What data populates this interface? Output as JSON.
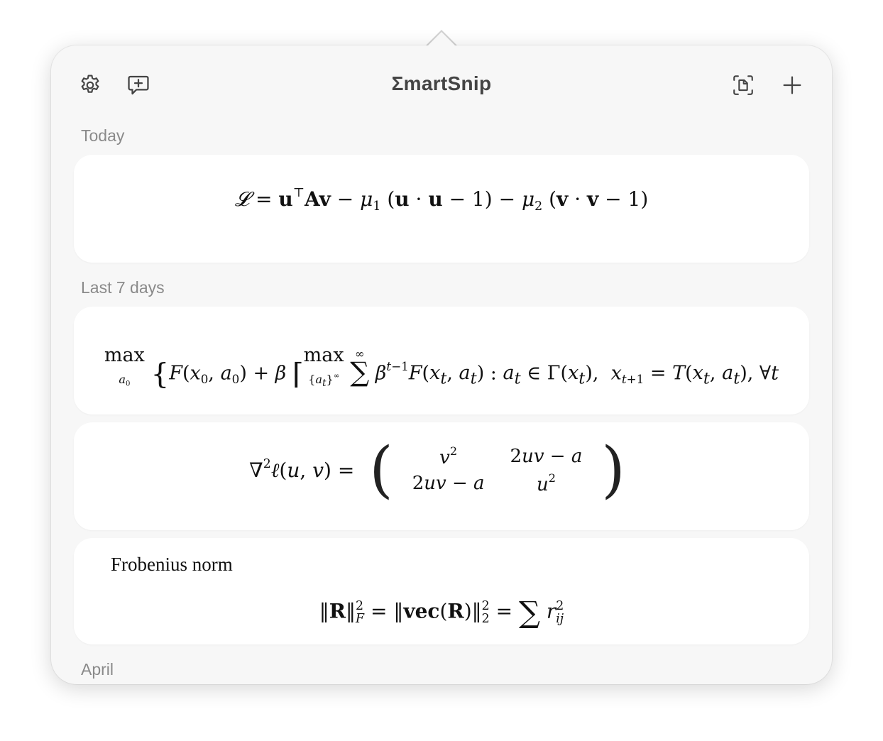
{
  "app": {
    "title": "ΣmartSnip"
  },
  "toolbar": {
    "left_icons": [
      "gear-icon",
      "chat-plus-icon"
    ],
    "right_icons": [
      "screen-capture-icon",
      "plus-icon"
    ]
  },
  "sections": {
    "today": "Today",
    "last7": "Last 7 days",
    "april": "April"
  },
  "snippets": {
    "lagrangian": "𝓛 = u⊤Av − μ₁ (u · u − 1) − μ₂ (v · v − 1)",
    "bellman": "max F(x₀, a₀) + β [ max ∑ β^(t−1) F(xₜ, aₜ) : aₜ ∈ Γ(xₜ), xₜ₊₁ = T(xₜ, aₜ), ∀t",
    "hessian_lhs": "∇²ℓ(u, v) =",
    "hessian_matrix": [
      [
        "v²",
        "2uv − a"
      ],
      [
        "2uv − a",
        "u²"
      ]
    ],
    "frobenius_note": "Frobenius norm",
    "frobenius": "‖R‖²_F = ‖vec(R)‖²₂ = ∑ r²ᵢⱼ"
  }
}
